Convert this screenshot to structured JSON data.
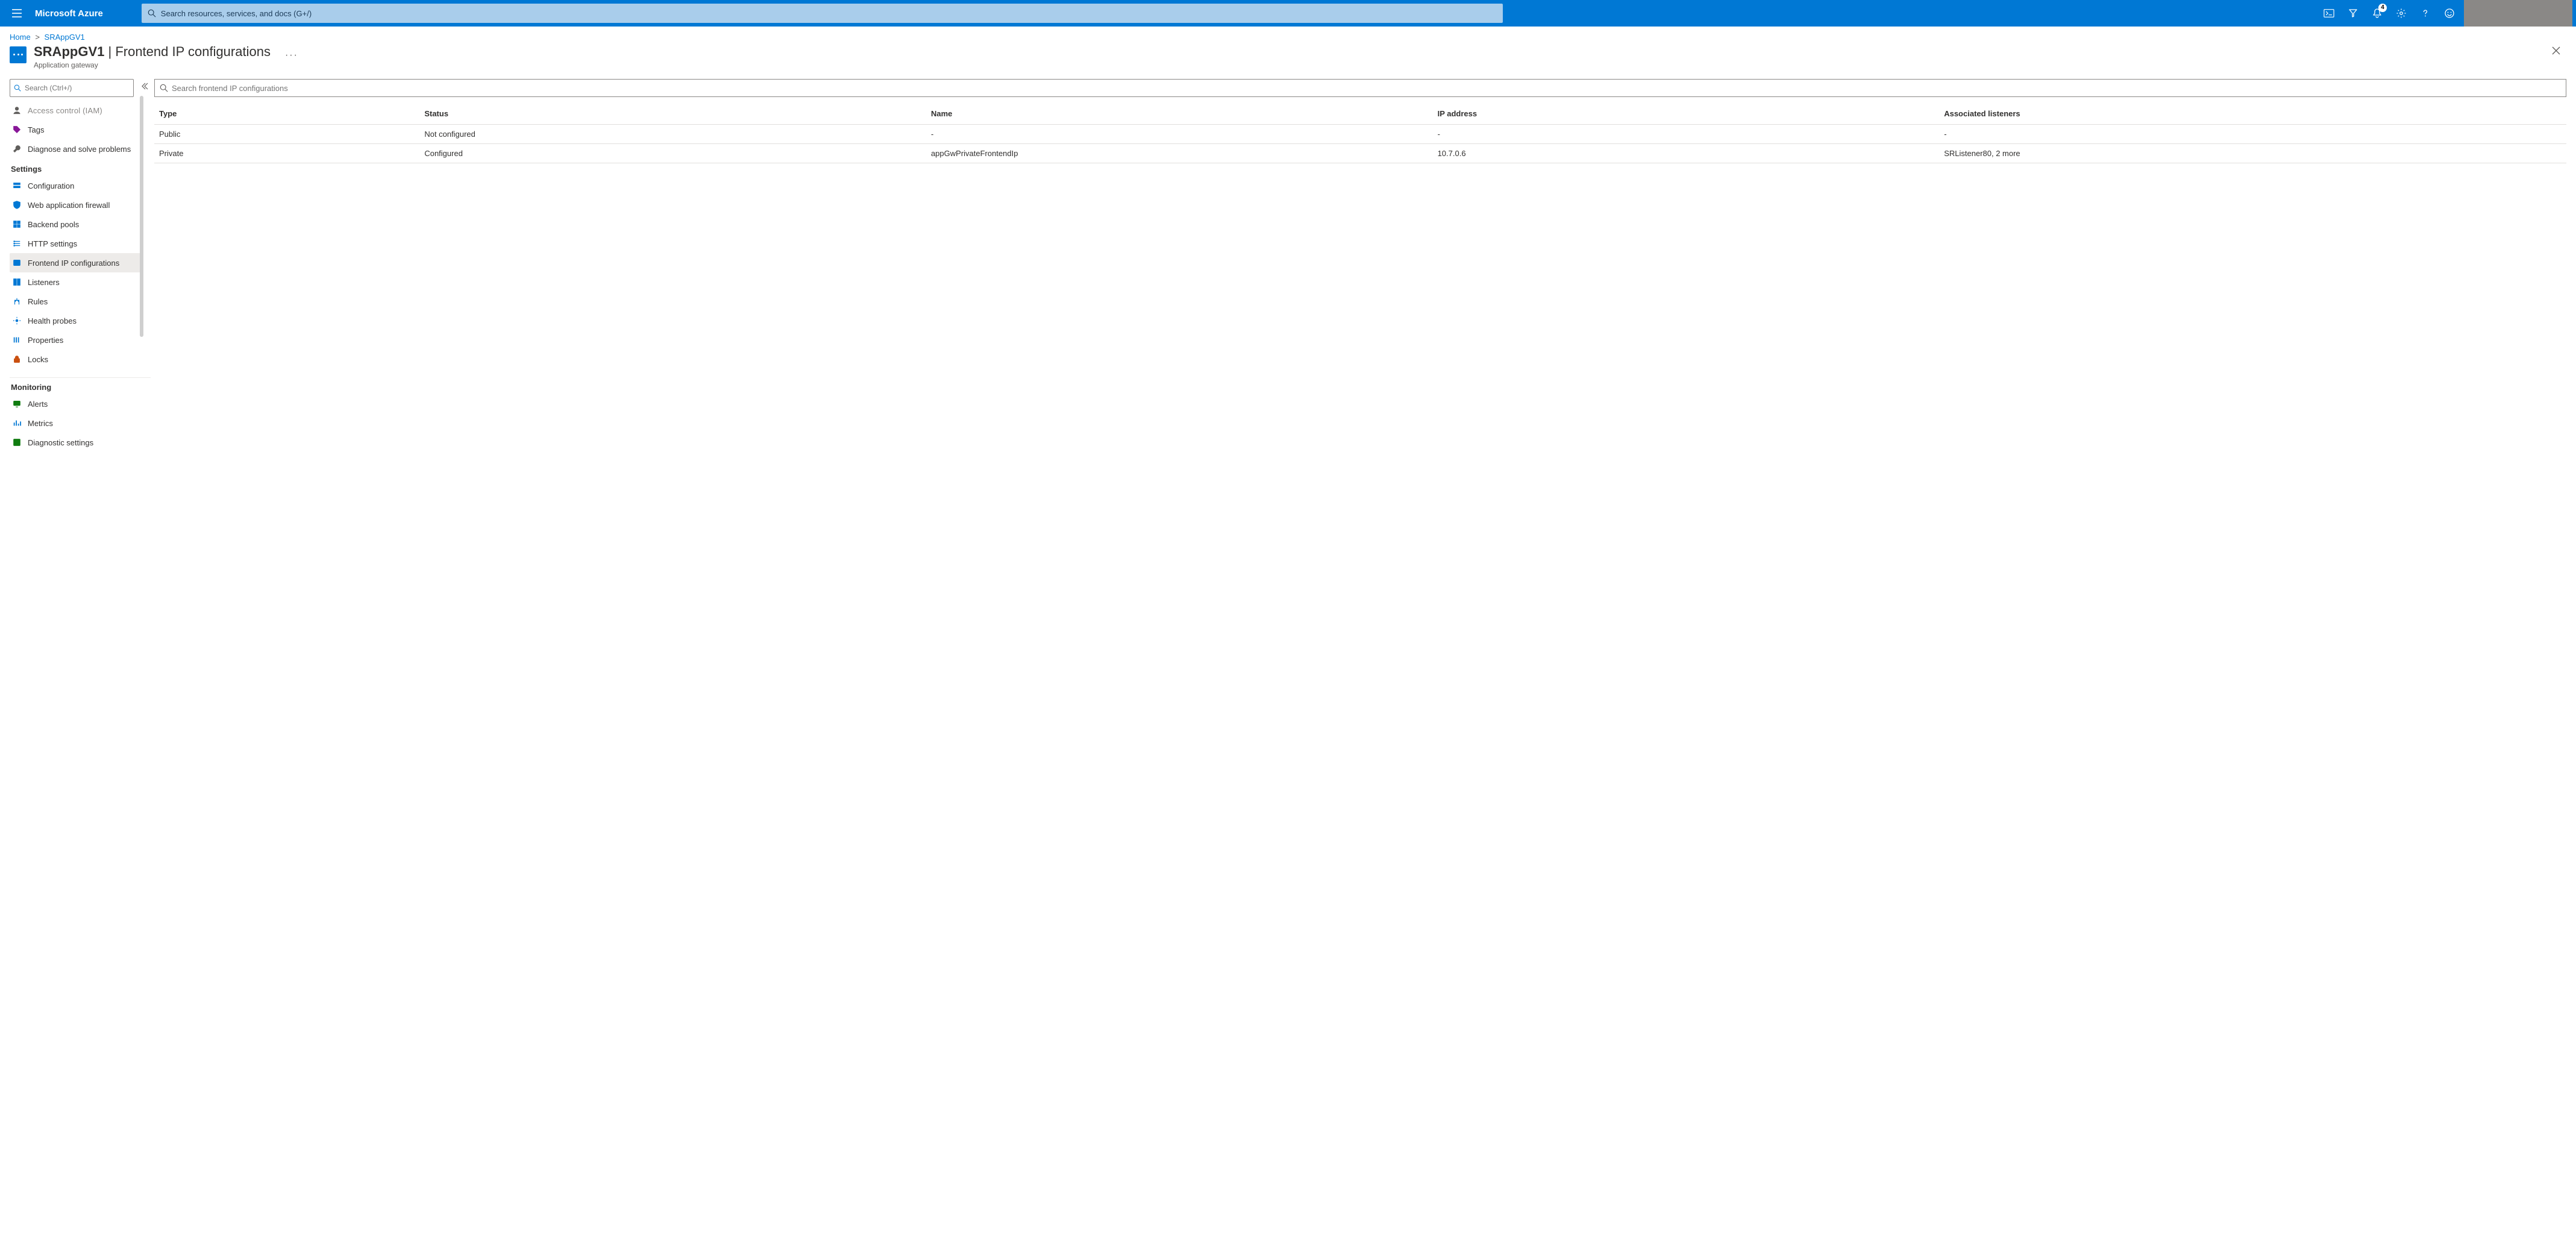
{
  "topbar": {
    "brand": "Microsoft Azure",
    "search_placeholder": "Search resources, services, and docs (G+/)",
    "notification_count": "4"
  },
  "breadcrumb": {
    "home": "Home",
    "current": "SRAppGV1"
  },
  "page": {
    "title_resource": "SRAppGV1",
    "title_blade": "Frontend IP configurations",
    "subtitle": "Application gateway",
    "more": "···"
  },
  "sidebar": {
    "search_placeholder": "Search (Ctrl+/)",
    "clipped_top": "Access control (IAM)",
    "top_items": [
      {
        "label": "Tags",
        "icon": "tag",
        "tint": "ic-purple"
      },
      {
        "label": "Diagnose and solve problems",
        "icon": "wrench",
        "tint": "ic-gray"
      }
    ],
    "sections": [
      {
        "title": "Settings",
        "items": [
          {
            "label": "Configuration",
            "icon": "config",
            "tint": "ic-blue"
          },
          {
            "label": "Web application firewall",
            "icon": "shield",
            "tint": "ic-blue"
          },
          {
            "label": "Backend pools",
            "icon": "pool",
            "tint": "ic-blue"
          },
          {
            "label": "HTTP settings",
            "icon": "http",
            "tint": "ic-blue"
          },
          {
            "label": "Frontend IP configurations",
            "icon": "ip",
            "tint": "ic-blue",
            "selected": true
          },
          {
            "label": "Listeners",
            "icon": "listen",
            "tint": "ic-blue"
          },
          {
            "label": "Rules",
            "icon": "rules",
            "tint": "ic-blue"
          },
          {
            "label": "Health probes",
            "icon": "probe",
            "tint": "ic-blue"
          },
          {
            "label": "Properties",
            "icon": "props",
            "tint": "ic-blue"
          },
          {
            "label": "Locks",
            "icon": "lock",
            "tint": "ic-orange"
          }
        ]
      },
      {
        "title": "Monitoring",
        "items": [
          {
            "label": "Alerts",
            "icon": "alert",
            "tint": "ic-green"
          },
          {
            "label": "Metrics",
            "icon": "metrics",
            "tint": "ic-blue"
          },
          {
            "label": "Diagnostic settings",
            "icon": "diag",
            "tint": "ic-green"
          }
        ]
      }
    ]
  },
  "main": {
    "search_placeholder": "Search frontend IP configurations",
    "columns": [
      "Type",
      "Status",
      "Name",
      "IP address",
      "Associated listeners"
    ],
    "rows": [
      {
        "type": "Public",
        "status": "Not configured",
        "name": "-",
        "ip": "-",
        "listeners": "-"
      },
      {
        "type": "Private",
        "status": "Configured",
        "name": "appGwPrivateFrontendIp",
        "ip": "10.7.0.6",
        "listeners": "SRListener80, 2 more"
      }
    ]
  }
}
